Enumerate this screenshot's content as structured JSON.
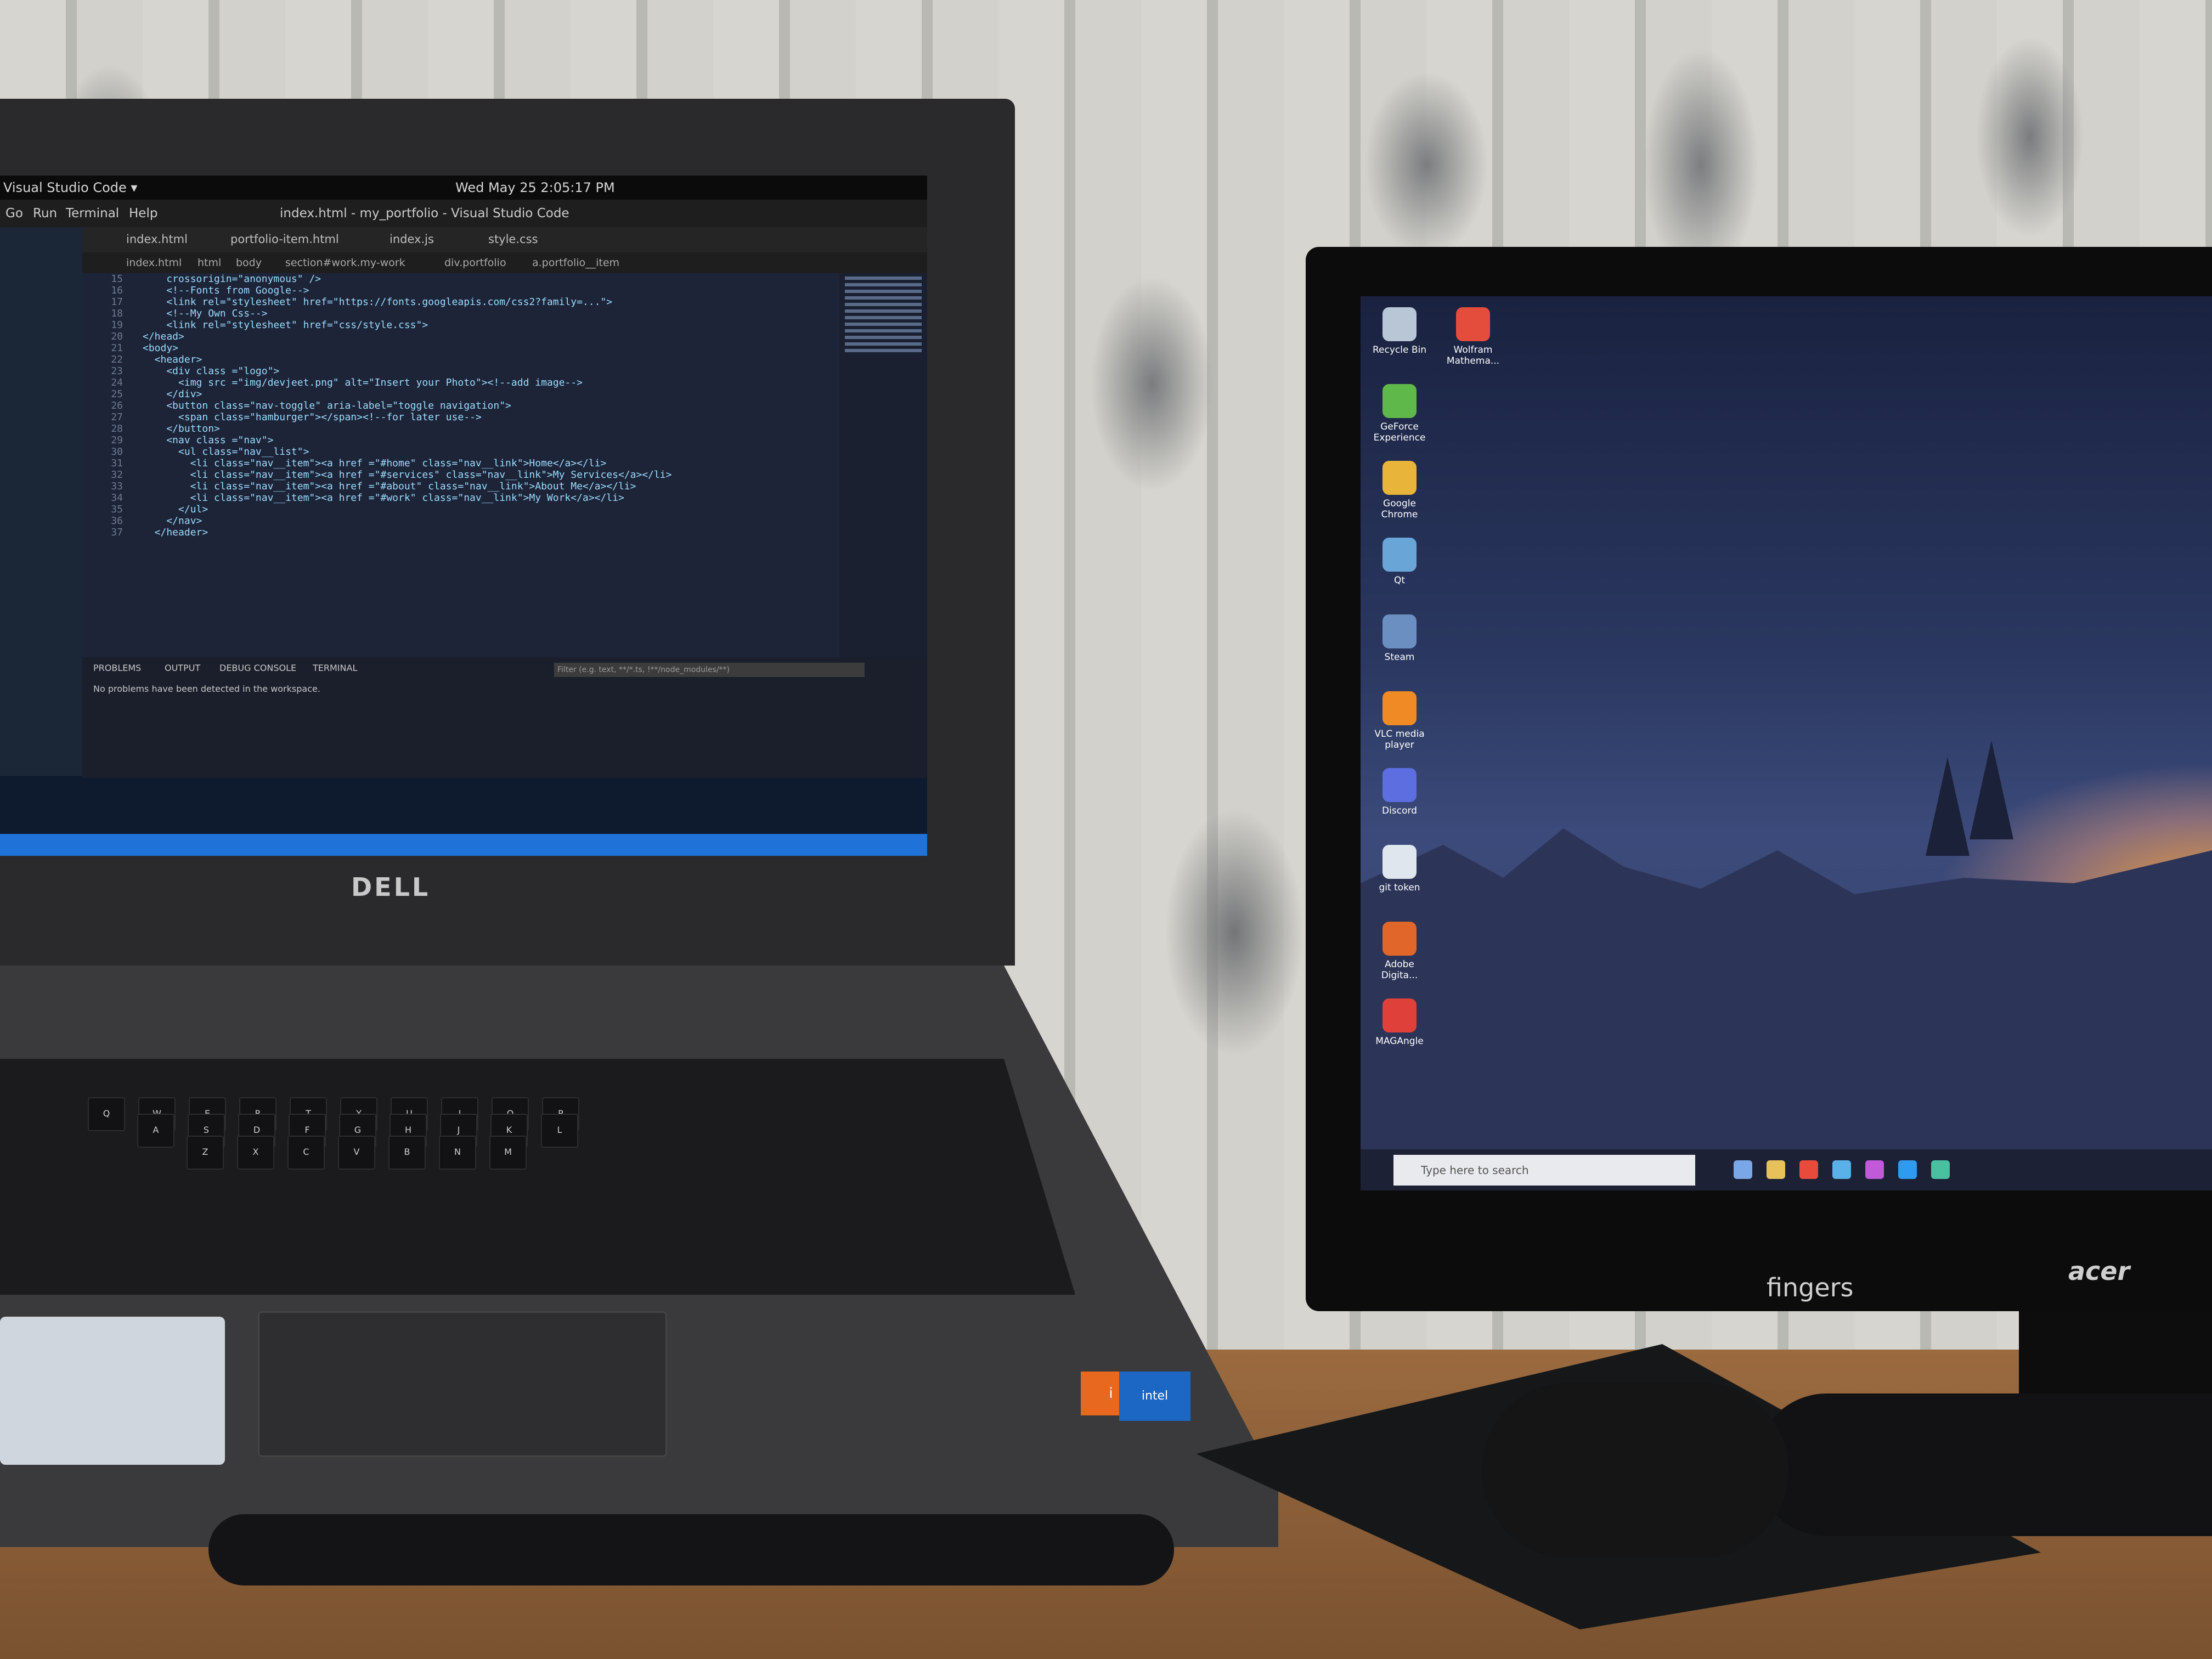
{
  "laptop": {
    "brand": "DELL",
    "topbar_app": "Visual Studio Code ▾",
    "topbar_clock": "Wed May 25  2:05:17 PM",
    "menu": [
      "Go",
      "Run",
      "Terminal",
      "Help"
    ],
    "window_title": "index.html - my_portfolio - Visual Studio Code",
    "tabs": [
      "index.html",
      "portfolio-item.html",
      "index.js",
      "style.css"
    ],
    "breadcrumbs": [
      "index.html",
      "html",
      "body",
      "section#work.my-work",
      "div.portfolio",
      "a.portfolio__item"
    ],
    "line_numbers": [
      "15",
      "16",
      "17",
      "18",
      "19",
      "20",
      "21",
      "22",
      "23",
      "24",
      "25",
      "26",
      "27",
      "28",
      "29",
      "30",
      "31",
      "32",
      "33",
      "34",
      "35",
      "36",
      "37"
    ],
    "code_lines": [
      "    crossorigin=\"anonymous\" />",
      "    <!--Fonts from Google-->",
      "    <link rel=\"stylesheet\" href=\"https://fonts.googleapis.com/css2?family=...\">",
      "    <!--My Own Css-->",
      "    <link rel=\"stylesheet\" href=\"css/style.css\">",
      "</head>",
      "<body>",
      "  <header>",
      "    <div class =\"logo\">",
      "      <img src =\"img/devjeet.png\" alt=\"Insert your Photo\"><!--add image-->",
      "    </div>",
      "    <button class=\"nav-toggle\" aria-label=\"toggle navigation\">",
      "      <span class=\"hamburger\"></span><!--for later use-->",
      "    </button>",
      "    <nav class =\"nav\">",
      "      <ul class=\"nav__list\">",
      "        <li class=\"nav__item\"><a href =\"#home\" class=\"nav__link\">Home</a></li>",
      "        <li class=\"nav__item\"><a href =\"#services\" class=\"nav__link\">My Services</a></li>",
      "        <li class=\"nav__item\"><a href =\"#about\" class=\"nav__link\">About Me</a></li>",
      "        <li class=\"nav__item\"><a href =\"#work\" class=\"nav__link\">My Work</a></li>",
      "      </ul>",
      "    </nav>",
      "  </header>"
    ],
    "panel_tabs": [
      "PROBLEMS",
      "OUTPUT",
      "DEBUG CONSOLE",
      "TERMINAL"
    ],
    "panel_message": "No problems have been detected in the workspace.",
    "panel_filter_placeholder": "Filter (e.g. text, **/*.ts, !**/node_modules/**)",
    "keyboard_row2": [
      "Q",
      "W",
      "E",
      "R",
      "T",
      "Y",
      "U",
      "I",
      "O",
      "P"
    ],
    "keyboard_row3": [
      "A",
      "S",
      "D",
      "F",
      "G",
      "H",
      "J",
      "K",
      "L"
    ],
    "keyboard_row4": [
      "Z",
      "X",
      "C",
      "V",
      "B",
      "N",
      "M"
    ],
    "sticker_orange": "i",
    "sticker_blue": "intel"
  },
  "monitor": {
    "brand": "acer",
    "label": "fingers",
    "desktop_icons": [
      "Recycle Bin",
      "Wolfram Mathema...",
      "GeForce Experience",
      "Google Chrome",
      "Qt",
      "Steam",
      "VLC media player",
      "Discord",
      "git token",
      "Adobe Digita...",
      "MAGAngle"
    ],
    "taskbar_search": "Type here to search",
    "colors": {
      "sky_top": "#1a2240",
      "sunset": "#e89a40",
      "taskbar": "#1d2135"
    }
  }
}
